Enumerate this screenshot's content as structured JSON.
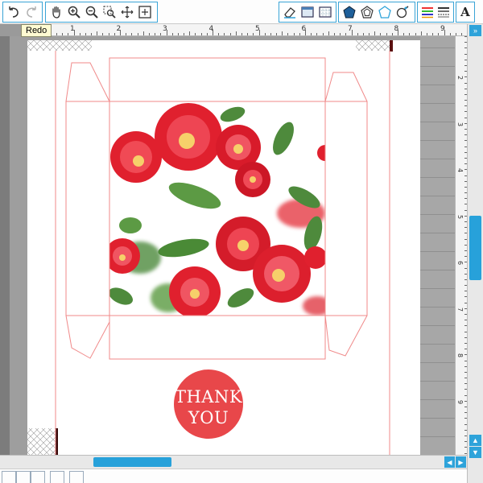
{
  "toolbar": {
    "undo": "undo-icon",
    "redo": "redo-icon",
    "pan": "pan-hand-icon",
    "zoom_in": "zoom-in-icon",
    "zoom_out": "zoom-out-icon",
    "zoom_select": "zoom-select-icon",
    "zoom_drag": "zoom-drag-icon",
    "zoom_fit": "zoom-fit-icon",
    "draw_tools": [
      "eraser-icon",
      "fill-panel-icon",
      "grid-panel-icon"
    ],
    "shape_tools": [
      "pentagon-filled-icon",
      "pentagon-outline-icon",
      "polygon-outline-icon",
      "polygon-pen-icon"
    ],
    "line_tools": [
      "line-color-icon",
      "line-style-icon"
    ],
    "text_tool": "A"
  },
  "tooltip": {
    "text": "Redo"
  },
  "ruler": {
    "horizontal": [
      "1",
      "2",
      "3",
      "4",
      "5",
      "6",
      "7",
      "8",
      "9"
    ],
    "vertical": [
      "2",
      "3",
      "4",
      "5",
      "6",
      "7",
      "8",
      "9"
    ]
  },
  "design": {
    "thank_line1": "THANK",
    "thank_line2": "YOU"
  },
  "colors": {
    "accent": "#2ea3da",
    "cut_line": "#f08a8a",
    "circle": "#e8474a",
    "leaf": "#4e8a3c",
    "flower": "#e0202e"
  },
  "scroll": {
    "up": "▲",
    "down": "▼",
    "left": "◀",
    "right": "▶",
    "expand": "»"
  }
}
